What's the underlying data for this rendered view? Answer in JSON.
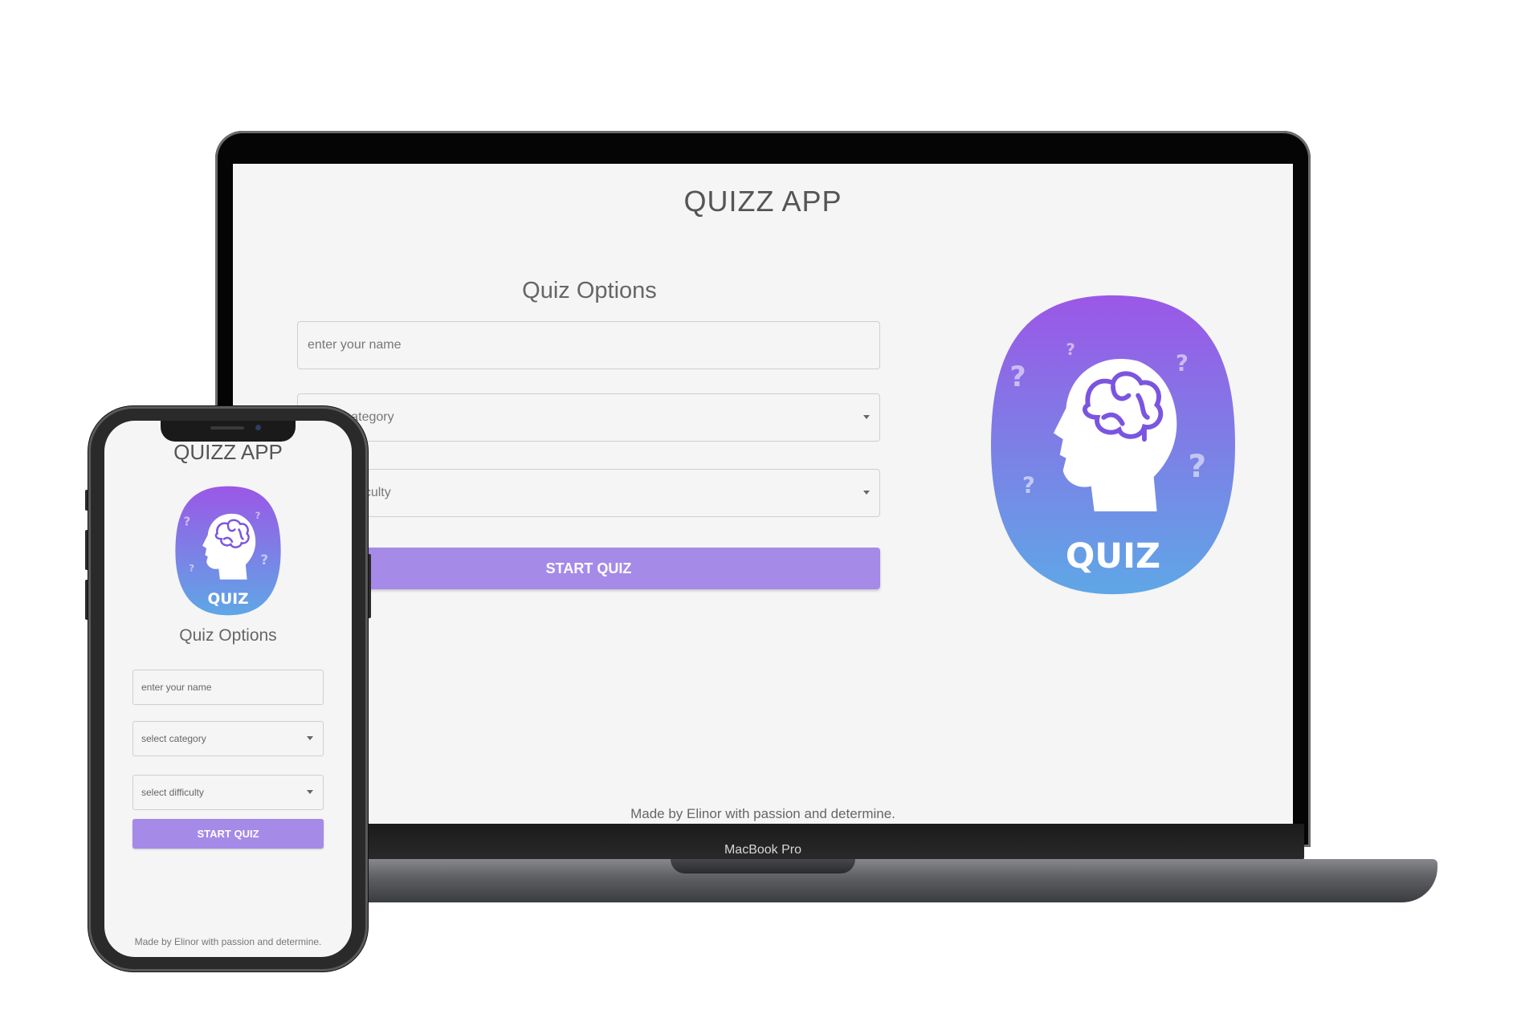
{
  "device_label": "MacBook Pro",
  "app": {
    "title": "QUIZZ APP",
    "options_heading": "Quiz Options",
    "name_input": {
      "placeholder": "enter your name",
      "value": ""
    },
    "category_select": {
      "selected": "select category"
    },
    "difficulty_select": {
      "selected": "select difficulty"
    },
    "start_button": "START QUIZ",
    "logo_text": "QUIZ",
    "footer": "Made by Elinor with passion and determine."
  },
  "colors": {
    "accent": "#a58ae8",
    "logo_gradient_top": "#9b57e6",
    "logo_gradient_bottom": "#5fa7e6",
    "background": "#f5f5f5"
  },
  "icons": [
    "brain-head-icon",
    "question-mark-icon",
    "dropdown-caret-icon"
  ]
}
